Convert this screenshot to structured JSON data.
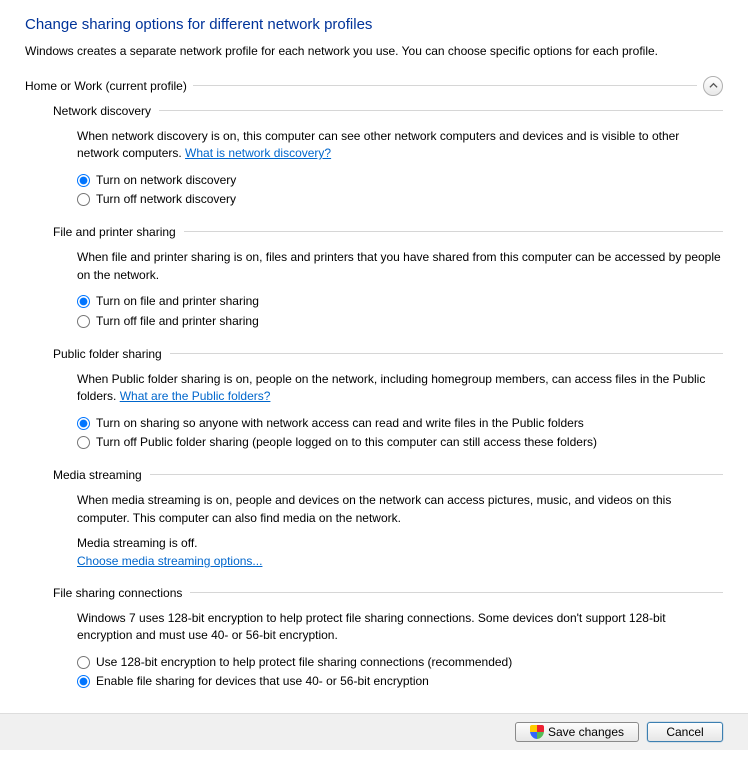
{
  "page": {
    "title": "Change sharing options for different network profiles",
    "intro": "Windows creates a separate network profile for each network you use. You can choose specific options for each profile."
  },
  "profile": {
    "title": "Home or Work (current profile)"
  },
  "discovery": {
    "title": "Network discovery",
    "desc1": "When network discovery is on, this computer can see other network computers and devices and is visible to other network computers. ",
    "link": "What is network discovery?",
    "on": "Turn on network discovery",
    "off": "Turn off network discovery"
  },
  "fps": {
    "title": "File and printer sharing",
    "desc": "When file and printer sharing is on, files and printers that you have shared from this computer can be accessed by people on the network.",
    "on": "Turn on file and printer sharing",
    "off": "Turn off file and printer sharing"
  },
  "pub": {
    "title": "Public folder sharing",
    "desc1": "When Public folder sharing is on, people on the network, including homegroup members, can access files in the Public folders. ",
    "link": "What are the Public folders?",
    "on": "Turn on sharing so anyone with network access can read and write files in the Public folders",
    "off": "Turn off Public folder sharing (people logged on to this computer can still access these folders)"
  },
  "media": {
    "title": "Media streaming",
    "desc": "When media streaming is on, people and devices on the network can access pictures, music, and videos on this computer. This computer can also find media on the network.",
    "status": "Media streaming is off.",
    "link": "Choose media streaming options..."
  },
  "enc": {
    "title": "File sharing connections",
    "desc": "Windows 7 uses 128-bit encryption to help protect file sharing connections. Some devices don't support 128-bit encryption and must use 40- or 56-bit encryption.",
    "opt128": "Use 128-bit encryption to help protect file sharing connections (recommended)",
    "opt40": "Enable file sharing for devices that use 40- or 56-bit encryption"
  },
  "buttons": {
    "save": "Save changes",
    "cancel": "Cancel"
  }
}
